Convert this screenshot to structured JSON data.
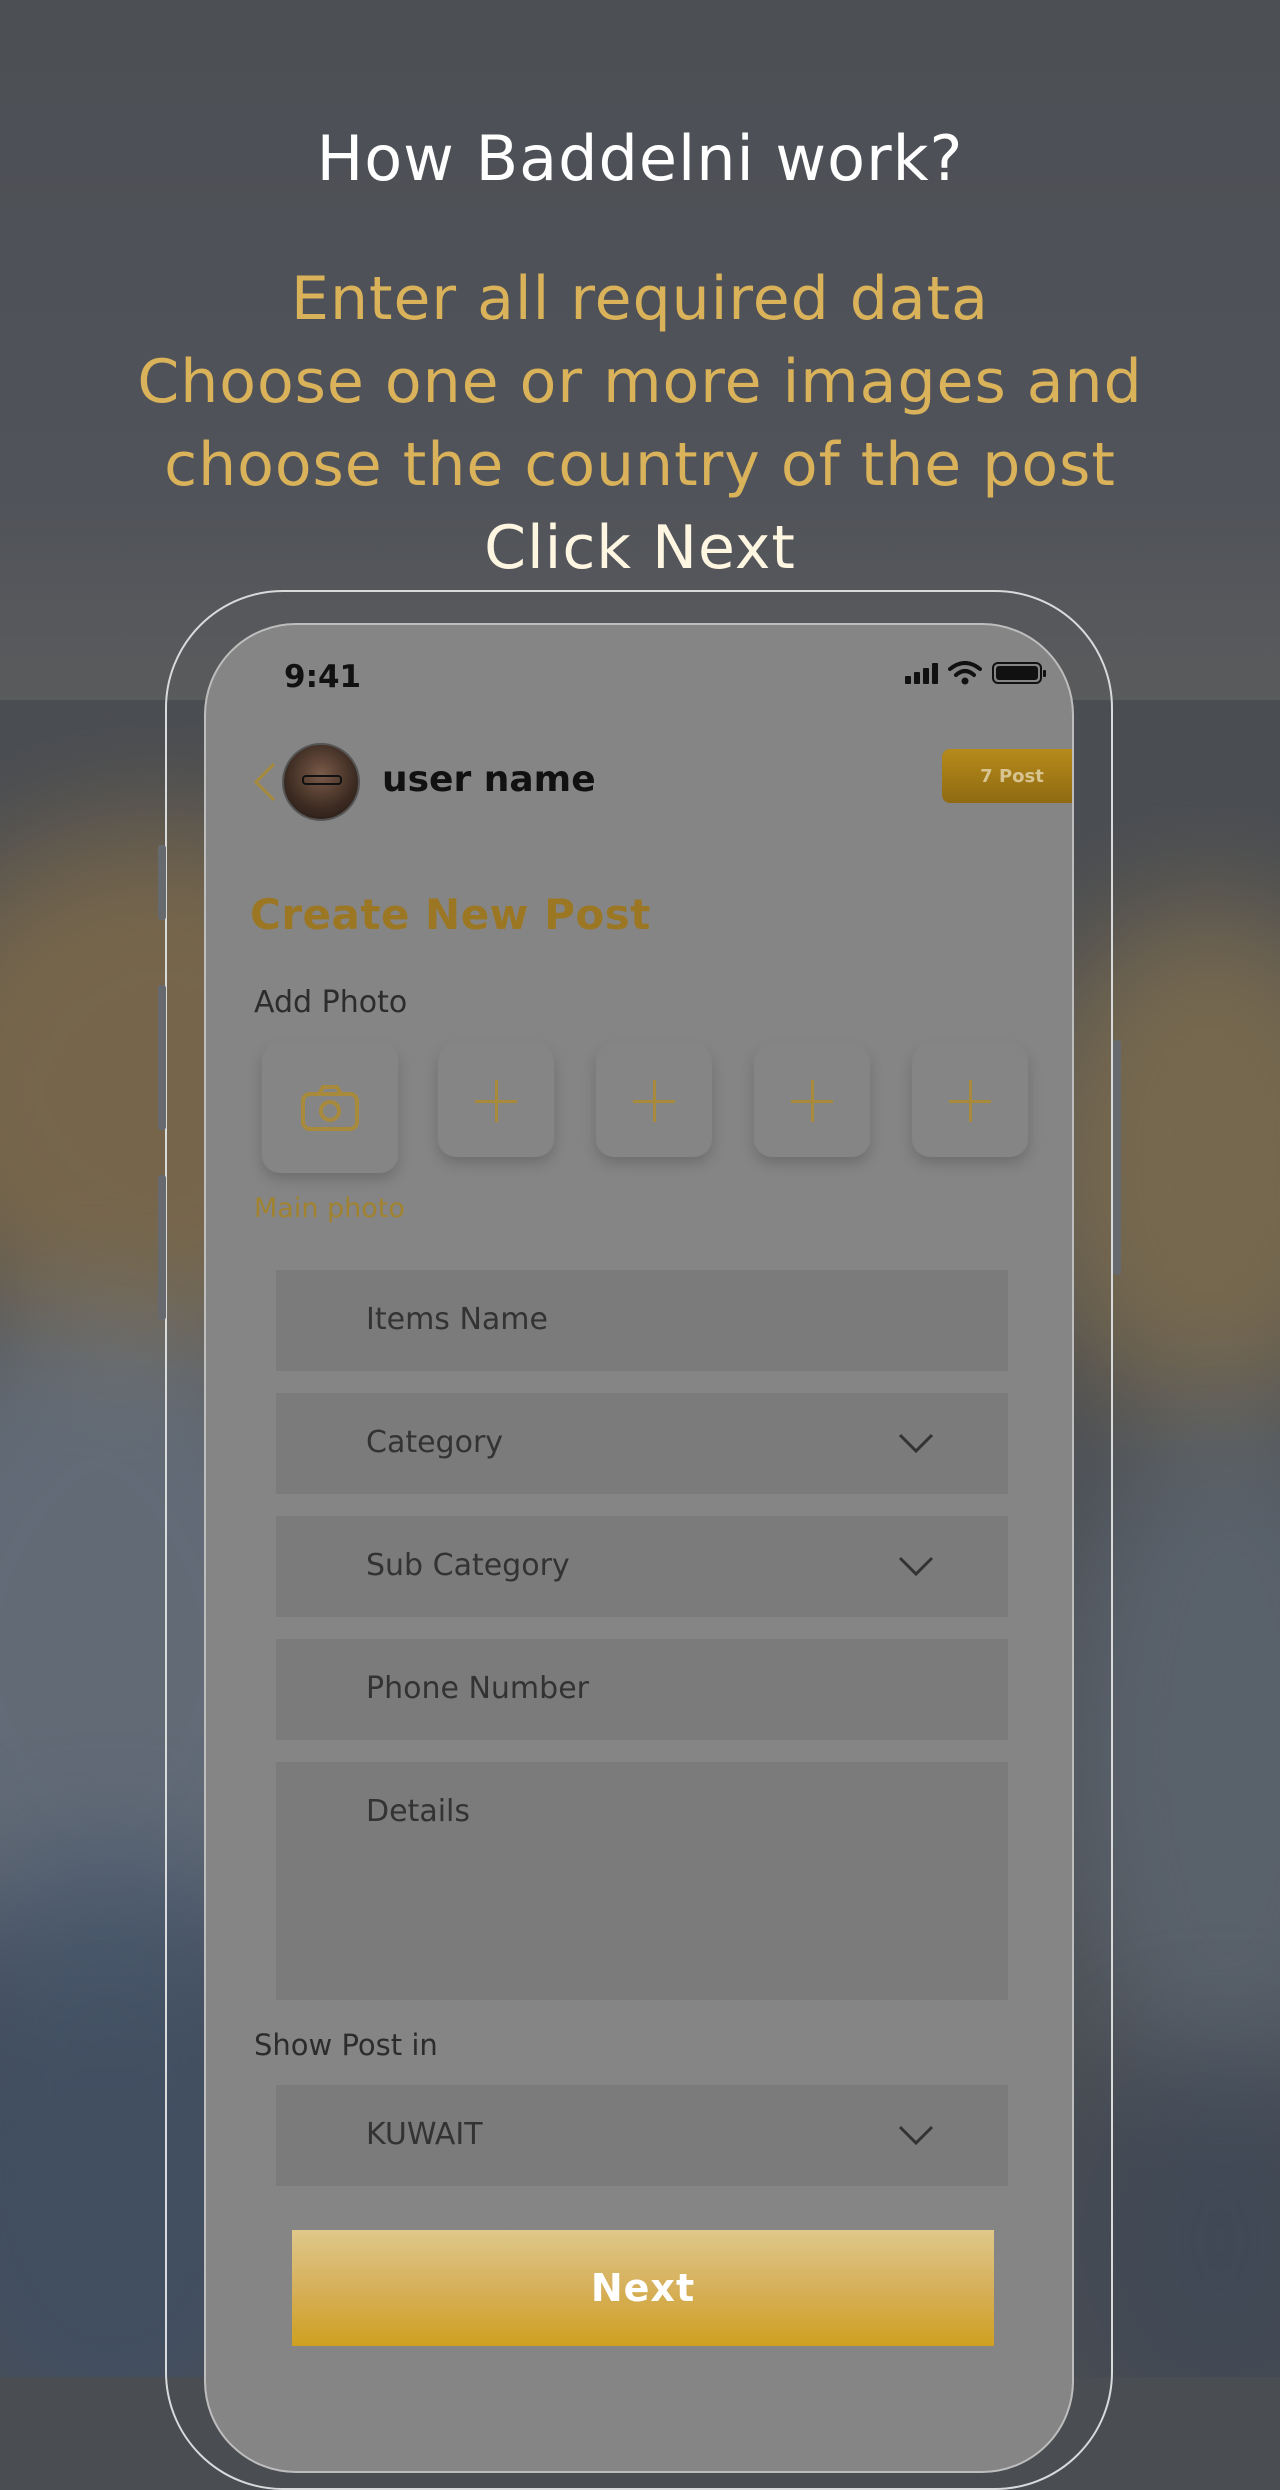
{
  "heading": "How Baddelni work?",
  "instructions": {
    "line1": "Enter all required data",
    "line2": "Choose one or more images and",
    "line3": "choose the country of the post",
    "line4": "Click Next"
  },
  "phone": {
    "status_time": "9:41",
    "user_name": "user name",
    "post_badge": "7 Post",
    "page_title": "Create New Post",
    "add_photo_label": "Add Photo",
    "main_photo_label": "Main photo",
    "fields": {
      "items_name": "Items Name",
      "category": "Category",
      "sub_category": "Sub Category",
      "phone_number": "Phone Number",
      "details": "Details"
    },
    "show_post_in_label": "Show Post in",
    "country": "KUWAIT",
    "next_label": "Next"
  },
  "colors": {
    "accent_gold": "#d9b25a",
    "title_gold": "#9c7723",
    "screen_gray": "#858585"
  },
  "icons": [
    "back-chevron-icon",
    "camera-icon",
    "plus-icon",
    "chevron-down-icon",
    "signal-icon",
    "wifi-icon",
    "battery-icon"
  ]
}
